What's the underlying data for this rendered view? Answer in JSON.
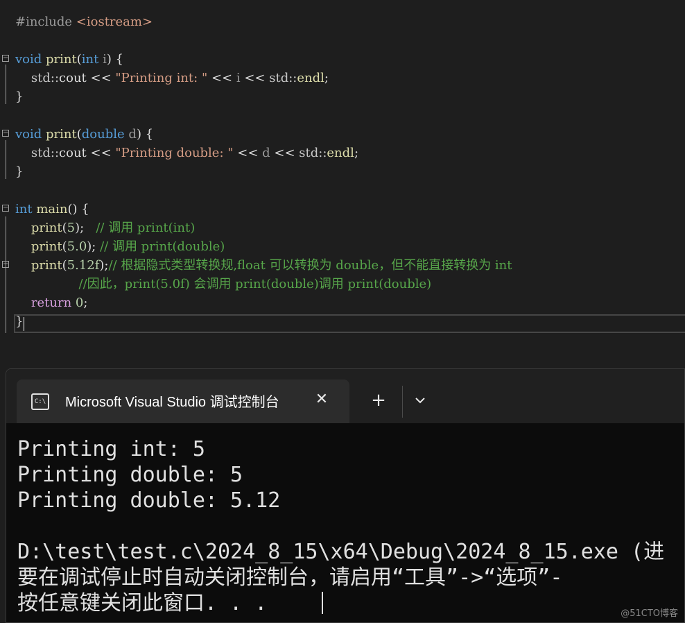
{
  "editor": {
    "lines": [
      {
        "segs": [
          {
            "c": "pp",
            "t": "#include"
          },
          {
            "c": "",
            "t": " "
          },
          {
            "c": "inc",
            "t": "<iostream>"
          }
        ]
      },
      {
        "segs": []
      },
      {
        "segs": [
          {
            "c": "kw",
            "t": "void"
          },
          {
            "c": "",
            "t": " "
          },
          {
            "c": "fn",
            "t": "print"
          },
          {
            "c": "",
            "t": "("
          },
          {
            "c": "kw",
            "t": "int"
          },
          {
            "c": "",
            "t": " "
          },
          {
            "c": "pm",
            "t": "i"
          },
          {
            "c": "",
            "t": ") {"
          }
        ]
      },
      {
        "segs": [
          {
            "c": "guide",
            "t": "  "
          },
          {
            "c": "ns",
            "t": "  std::"
          },
          {
            "c": "",
            "t": "cout "
          },
          {
            "c": "",
            "t": "<<"
          },
          {
            "c": "",
            "t": " "
          },
          {
            "c": "str",
            "t": "\"Printing int: \""
          },
          {
            "c": "",
            "t": " << "
          },
          {
            "c": "pm",
            "t": "i"
          },
          {
            "c": "",
            "t": " << "
          },
          {
            "c": "ns",
            "t": "std::"
          },
          {
            "c": "fn",
            "t": "endl"
          },
          {
            "c": "",
            "t": ";"
          }
        ]
      },
      {
        "segs": [
          {
            "c": "",
            "t": "}"
          }
        ]
      },
      {
        "segs": []
      },
      {
        "segs": [
          {
            "c": "kw",
            "t": "void"
          },
          {
            "c": "",
            "t": " "
          },
          {
            "c": "fn",
            "t": "print"
          },
          {
            "c": "",
            "t": "("
          },
          {
            "c": "kw",
            "t": "double"
          },
          {
            "c": "",
            "t": " "
          },
          {
            "c": "pm",
            "t": "d"
          },
          {
            "c": "",
            "t": ") {"
          }
        ]
      },
      {
        "segs": [
          {
            "c": "guide",
            "t": "  "
          },
          {
            "c": "ns",
            "t": "  std::"
          },
          {
            "c": "",
            "t": "cout "
          },
          {
            "c": "",
            "t": "<<"
          },
          {
            "c": "",
            "t": " "
          },
          {
            "c": "str",
            "t": "\"Printing double: \""
          },
          {
            "c": "",
            "t": " << "
          },
          {
            "c": "pm",
            "t": "d"
          },
          {
            "c": "",
            "t": " << "
          },
          {
            "c": "ns",
            "t": "std::"
          },
          {
            "c": "fn",
            "t": "endl"
          },
          {
            "c": "",
            "t": ";"
          }
        ]
      },
      {
        "segs": [
          {
            "c": "",
            "t": "}"
          }
        ]
      },
      {
        "segs": []
      },
      {
        "segs": [
          {
            "c": "kw",
            "t": "int"
          },
          {
            "c": "",
            "t": " "
          },
          {
            "c": "fn",
            "t": "main"
          },
          {
            "c": "",
            "t": "() {"
          }
        ]
      },
      {
        "segs": [
          {
            "c": "",
            "t": "    "
          },
          {
            "c": "fn",
            "t": "print"
          },
          {
            "c": "",
            "t": "("
          },
          {
            "c": "num",
            "t": "5"
          },
          {
            "c": "",
            "t": ");   "
          },
          {
            "c": "cm",
            "t": "// 调用 print(int)"
          }
        ]
      },
      {
        "segs": [
          {
            "c": "",
            "t": "    "
          },
          {
            "c": "fn",
            "t": "print"
          },
          {
            "c": "",
            "t": "("
          },
          {
            "c": "num",
            "t": "5.0"
          },
          {
            "c": "",
            "t": "); "
          },
          {
            "c": "cm",
            "t": "// 调用 print(double)"
          }
        ]
      },
      {
        "segs": [
          {
            "c": "",
            "t": "    "
          },
          {
            "c": "fn",
            "t": "print"
          },
          {
            "c": "",
            "t": "("
          },
          {
            "c": "num",
            "t": "5.12f"
          },
          {
            "c": "",
            "t": ");"
          },
          {
            "c": "cm",
            "t": "// 根据隐式类型转换规,float 可以转换为 double，但不能直接转换为 int"
          }
        ]
      },
      {
        "segs": [
          {
            "c": "",
            "t": "                "
          },
          {
            "c": "cm",
            "t": "//因此，print(5.0f) 会调用 print(double)调用 print(double)"
          }
        ]
      },
      {
        "segs": [
          {
            "c": "",
            "t": "    "
          },
          {
            "c": "ctl",
            "t": "return"
          },
          {
            "c": "",
            "t": " "
          },
          {
            "c": "num",
            "t": "0"
          },
          {
            "c": "",
            "t": ";"
          }
        ]
      },
      {
        "segs": [
          {
            "c": "",
            "t": "}"
          }
        ]
      }
    ]
  },
  "terminal": {
    "tab_title": "Microsoft Visual Studio 调试控制台",
    "tab_icon_text": "C:\\",
    "close_glyph": "✕",
    "new_tab_glyph": "+",
    "output": [
      "Printing int: 5",
      "Printing double: 5",
      "Printing double: 5.12",
      "",
      "D:\\test\\test.c\\2024_8_15\\x64\\Debug\\2024_8_15.exe (进",
      "要在调试停止时自动关闭控制台，请启用“工具”->“选项”-",
      "按任意键关闭此窗口. . ."
    ]
  },
  "watermark": "@51CTO博客"
}
